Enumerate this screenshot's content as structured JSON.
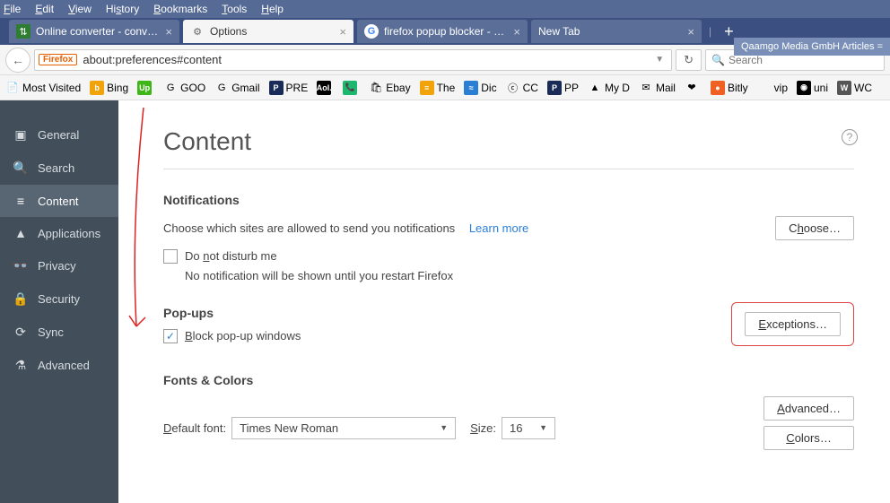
{
  "menu": [
    "File",
    "Edit",
    "View",
    "History",
    "Bookmarks",
    "Tools",
    "Help"
  ],
  "tabs": [
    {
      "label": "Online converter - convert …",
      "active": false,
      "icon": "🟩"
    },
    {
      "label": "Options",
      "active": true,
      "icon": "⚙"
    },
    {
      "label": "firefox popup blocker - Goo…",
      "active": false,
      "icon": "G"
    },
    {
      "label": "New Tab",
      "active": false,
      "icon": ""
    }
  ],
  "toast": "Qaamgo Media GmbH Articles =",
  "url": {
    "brand": "Firefox",
    "text": "about:preferences#content"
  },
  "search_placeholder": "Search",
  "bookmarks": [
    {
      "label": "Most Visited",
      "icon": "📄",
      "bg": ""
    },
    {
      "label": "Bing",
      "icon": "b",
      "bg": "#f0a30a"
    },
    {
      "label": "",
      "icon": "Up",
      "bg": "#3fb618"
    },
    {
      "label": "GOO",
      "icon": "G",
      "bg": ""
    },
    {
      "label": "Gmail",
      "icon": "G",
      "bg": ""
    },
    {
      "label": "PRE",
      "icon": "P",
      "bg": "#1a2b57"
    },
    {
      "label": "",
      "icon": "Aol.",
      "bg": "#000"
    },
    {
      "label": "",
      "icon": "📞",
      "bg": "#1eb76e"
    },
    {
      "label": "Ebay",
      "icon": "🛍",
      "bg": ""
    },
    {
      "label": "The",
      "icon": "≡",
      "bg": "#f0a30a"
    },
    {
      "label": "Dic",
      "icon": "≈",
      "bg": "#2a7fd4"
    },
    {
      "label": "CC",
      "icon": "ⓒ",
      "bg": ""
    },
    {
      "label": "PP",
      "icon": "P",
      "bg": "#1a2b57"
    },
    {
      "label": "My D",
      "icon": "▲",
      "bg": ""
    },
    {
      "label": "Mail",
      "icon": "✉",
      "bg": ""
    },
    {
      "label": "",
      "icon": "❤",
      "bg": ""
    },
    {
      "label": "Bitly",
      "icon": "●",
      "bg": "#ee6123"
    },
    {
      "label": "vip",
      "icon": "",
      "bg": ""
    },
    {
      "label": "uni",
      "icon": "◉",
      "bg": "#000"
    },
    {
      "label": "WC",
      "icon": "W",
      "bg": "#555"
    }
  ],
  "sidebar": [
    {
      "label": "General",
      "icon": "▣"
    },
    {
      "label": "Search",
      "icon": "🔍"
    },
    {
      "label": "Content",
      "icon": "≡",
      "active": true
    },
    {
      "label": "Applications",
      "icon": "▲"
    },
    {
      "label": "Privacy",
      "icon": "👓"
    },
    {
      "label": "Security",
      "icon": "🔒"
    },
    {
      "label": "Sync",
      "icon": "⟳"
    },
    {
      "label": "Advanced",
      "icon": "⚗"
    }
  ],
  "page": {
    "title": "Content",
    "notifications": {
      "heading": "Notifications",
      "desc": "Choose which sites are allowed to send you notifications",
      "learn": "Learn more",
      "choose": "Choose…",
      "dnd": "Do not disturb me",
      "dnd_sub": "No notification will be shown until you restart Firefox"
    },
    "popups": {
      "heading": "Pop-ups",
      "block": "Block pop-up windows",
      "block_checked": true,
      "exceptions": "Exceptions…"
    },
    "fonts": {
      "heading": "Fonts & Colors",
      "default_label": "Default font:",
      "default_value": "Times New Roman",
      "size_label": "Size:",
      "size_value": "16",
      "advanced": "Advanced…",
      "colors": "Colors…"
    }
  }
}
